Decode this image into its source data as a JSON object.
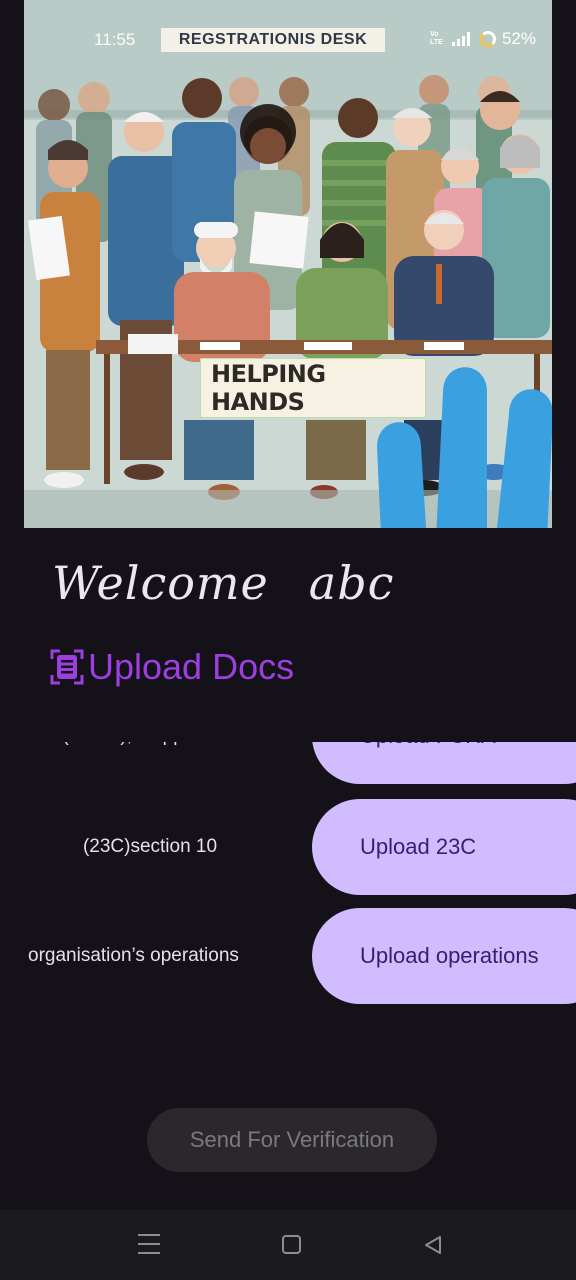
{
  "status_bar": {
    "time": "11:55",
    "network_label": "Vo LTE",
    "battery": "52%"
  },
  "hero_image": {
    "desk_sign": "REGSTRATIONIS DESK",
    "banner_text": "HELPING HANDS"
  },
  "welcome": {
    "greeting": "Welcome",
    "username": "abc"
  },
  "upload_section": {
    "title": "Upload Docs",
    "documents": [
      {
        "label": "(FCRA), if applicable",
        "button": "Upload FCRA"
      },
      {
        "label": "(23C)section 10",
        "button": "Upload 23C"
      },
      {
        "label": "organisation’s operations",
        "button": "Upload operations"
      }
    ]
  },
  "verify_button": "Send For Verification",
  "colors": {
    "background": "#141218",
    "button_fill": "#d0bcff",
    "button_text": "#381e72",
    "heading_accent": "#9c3ee0",
    "disabled_button": "#2a282d"
  },
  "icons": [
    "document-scan-icon",
    "menu-icon",
    "home-icon",
    "back-icon"
  ]
}
